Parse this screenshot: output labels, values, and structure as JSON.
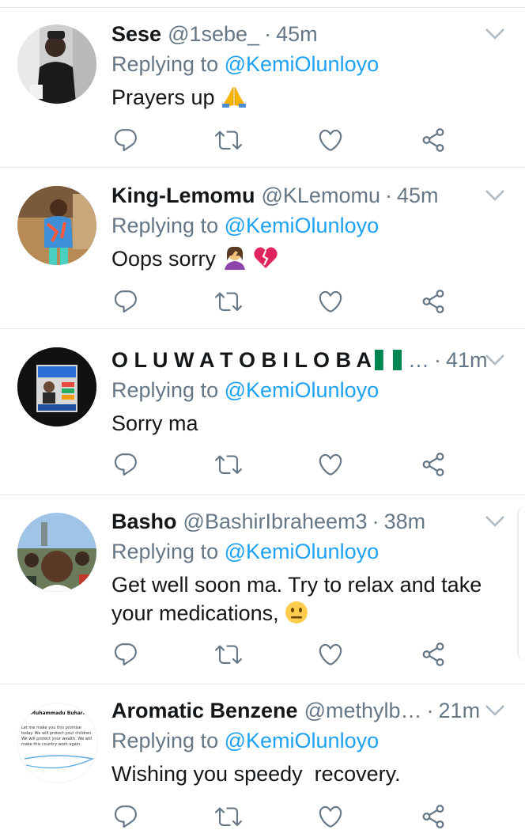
{
  "tweets": [
    {
      "name": "Sese",
      "handle": "@1sebe_",
      "dot": "·",
      "time": "45m",
      "reply_prefix": "Replying to",
      "reply_to": "@KemiOlunloyo",
      "text": "Prayers up",
      "emoji": "pray"
    },
    {
      "name": "King-Lemomu",
      "handle": "@KLemomu",
      "dot": "·",
      "time": "45m",
      "reply_prefix": "Replying to",
      "reply_to": "@KemiOlunloyo",
      "text": "Oops sorry",
      "emoji": "facepalm, broken-heart"
    },
    {
      "name": "O L U W A T O B I L O B A",
      "handle": "…",
      "dot": "·",
      "time": "41m",
      "reply_prefix": "Replying to",
      "reply_to": "@KemiOlunloyo",
      "text": "Sorry ma",
      "emoji": "nigeria-flag"
    },
    {
      "name": "Basho",
      "handle": "@BashirIbraheem3",
      "dot": "·",
      "time": "38m",
      "reply_prefix": "Replying to",
      "reply_to": "@KemiOlunloyo",
      "text_line1": "Get well soon ma. Try to relax and take",
      "text_line2": "your medications,",
      "emoji": "neutral-face"
    },
    {
      "name": "Aromatic Benzene",
      "handle": "@methylb…",
      "dot": "·",
      "time": "21m",
      "reply_prefix": "Replying to",
      "reply_to": "@KemiOlunloyo",
      "text": "Wishing you speedy  recovery."
    }
  ],
  "avatar5_text": {
    "title": "Muhammadu Buhari",
    "line1": "Let me make you this promise",
    "line2": "today. We will protect your children.",
    "line3": "We will protect your wealth. We will",
    "line4": "make this country work again."
  },
  "icons": [
    "reply-icon",
    "retweet-icon",
    "like-icon",
    "share-icon",
    "chevron-down-icon"
  ],
  "colors": {
    "name": "#14171a",
    "muted": "#657786",
    "link": "#1da1f2",
    "divider": "#e1e8ed",
    "icon": "#657786"
  }
}
